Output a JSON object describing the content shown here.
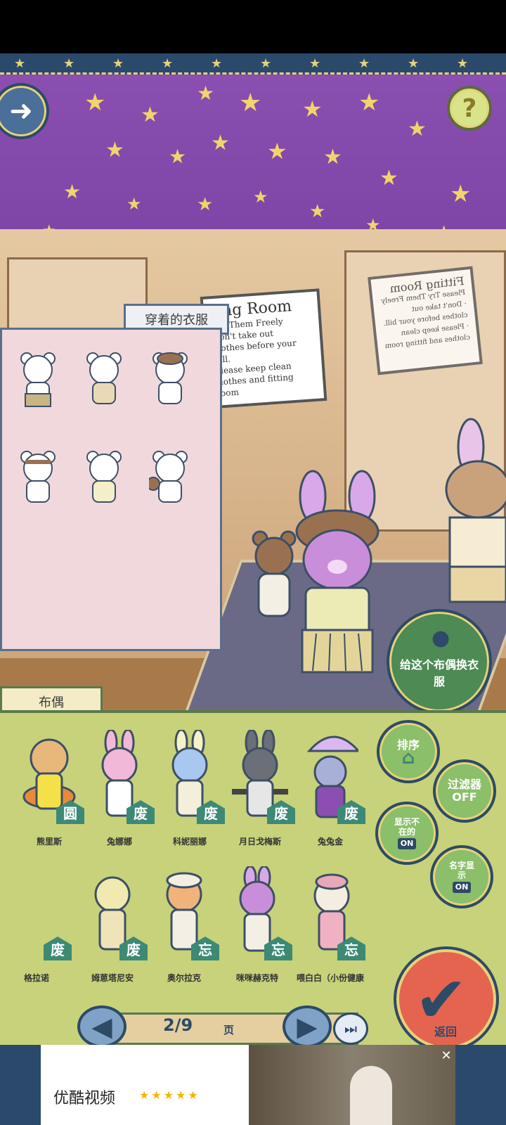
{
  "colors": {
    "ceiling": "#8a4fb0",
    "star": "#f2d46a",
    "clothes_panel": "#f1d8dc",
    "doll_panel": "#c7d27a",
    "badge": "#3c8a76",
    "confirm": "#e46450",
    "outline": "#2d4b66"
  },
  "top_controls": {
    "next_icon": "arrow-right-icon",
    "help_label": "?"
  },
  "signs": {
    "front": {
      "title": "ting Room",
      "line1": "Try Them Freely",
      "line2": "Don't take out",
      "line3": "clothes before your bill.",
      "line4": "Please keep clean",
      "line5": "clothes and fitting room"
    },
    "back": {
      "title": "Fitting Room",
      "line1": "Please Try Them Freely",
      "line2": "· Don't take out",
      "line3": "clothes before your bill.",
      "line4": "· Please keep clean",
      "line5": "clothes and fitting room"
    }
  },
  "clothes_panel": {
    "tab_label": "穿着的衣服",
    "items": [
      "bear-with-skirt",
      "bear-with-vest",
      "bear-with-beret",
      "bear-with-headband",
      "bear-with-top",
      "bear-with-teddy"
    ]
  },
  "dress_button": {
    "label": "给这个布偶换衣服"
  },
  "doll_panel": {
    "tab_label": "布偶",
    "row1": [
      {
        "name": "熊里斯",
        "badge": "圆"
      },
      {
        "name": "兔娜娜",
        "badge": "废"
      },
      {
        "name": "科妮丽娜",
        "badge": "废"
      },
      {
        "name": "月日戈梅斯",
        "badge": "废"
      },
      {
        "name": "兔兔金",
        "badge": "废"
      }
    ],
    "row2": [
      {
        "name": "格拉诺",
        "badge": "废"
      },
      {
        "name": "姆葸塔尼安",
        "badge": "废"
      },
      {
        "name": "奥尔拉克",
        "badge": "忘"
      },
      {
        "name": "咪咪赫克特",
        "badge": "忘"
      },
      {
        "name": "喂白白（小份健康",
        "badge": "忘"
      }
    ]
  },
  "side_buttons": {
    "sort_label": "排序",
    "filter_label": "过滤器",
    "filter_state": "OFF",
    "show_absent_label": "显示不在的",
    "show_absent_toggle": "ON",
    "show_name_label": "名字显示",
    "show_name_toggle": "ON"
  },
  "pager": {
    "current": "2/9",
    "unit": "页"
  },
  "confirm_button": {
    "label": "返回"
  },
  "ad": {
    "title": "优酷视频",
    "stars": "★★★★★",
    "close": "✕"
  }
}
